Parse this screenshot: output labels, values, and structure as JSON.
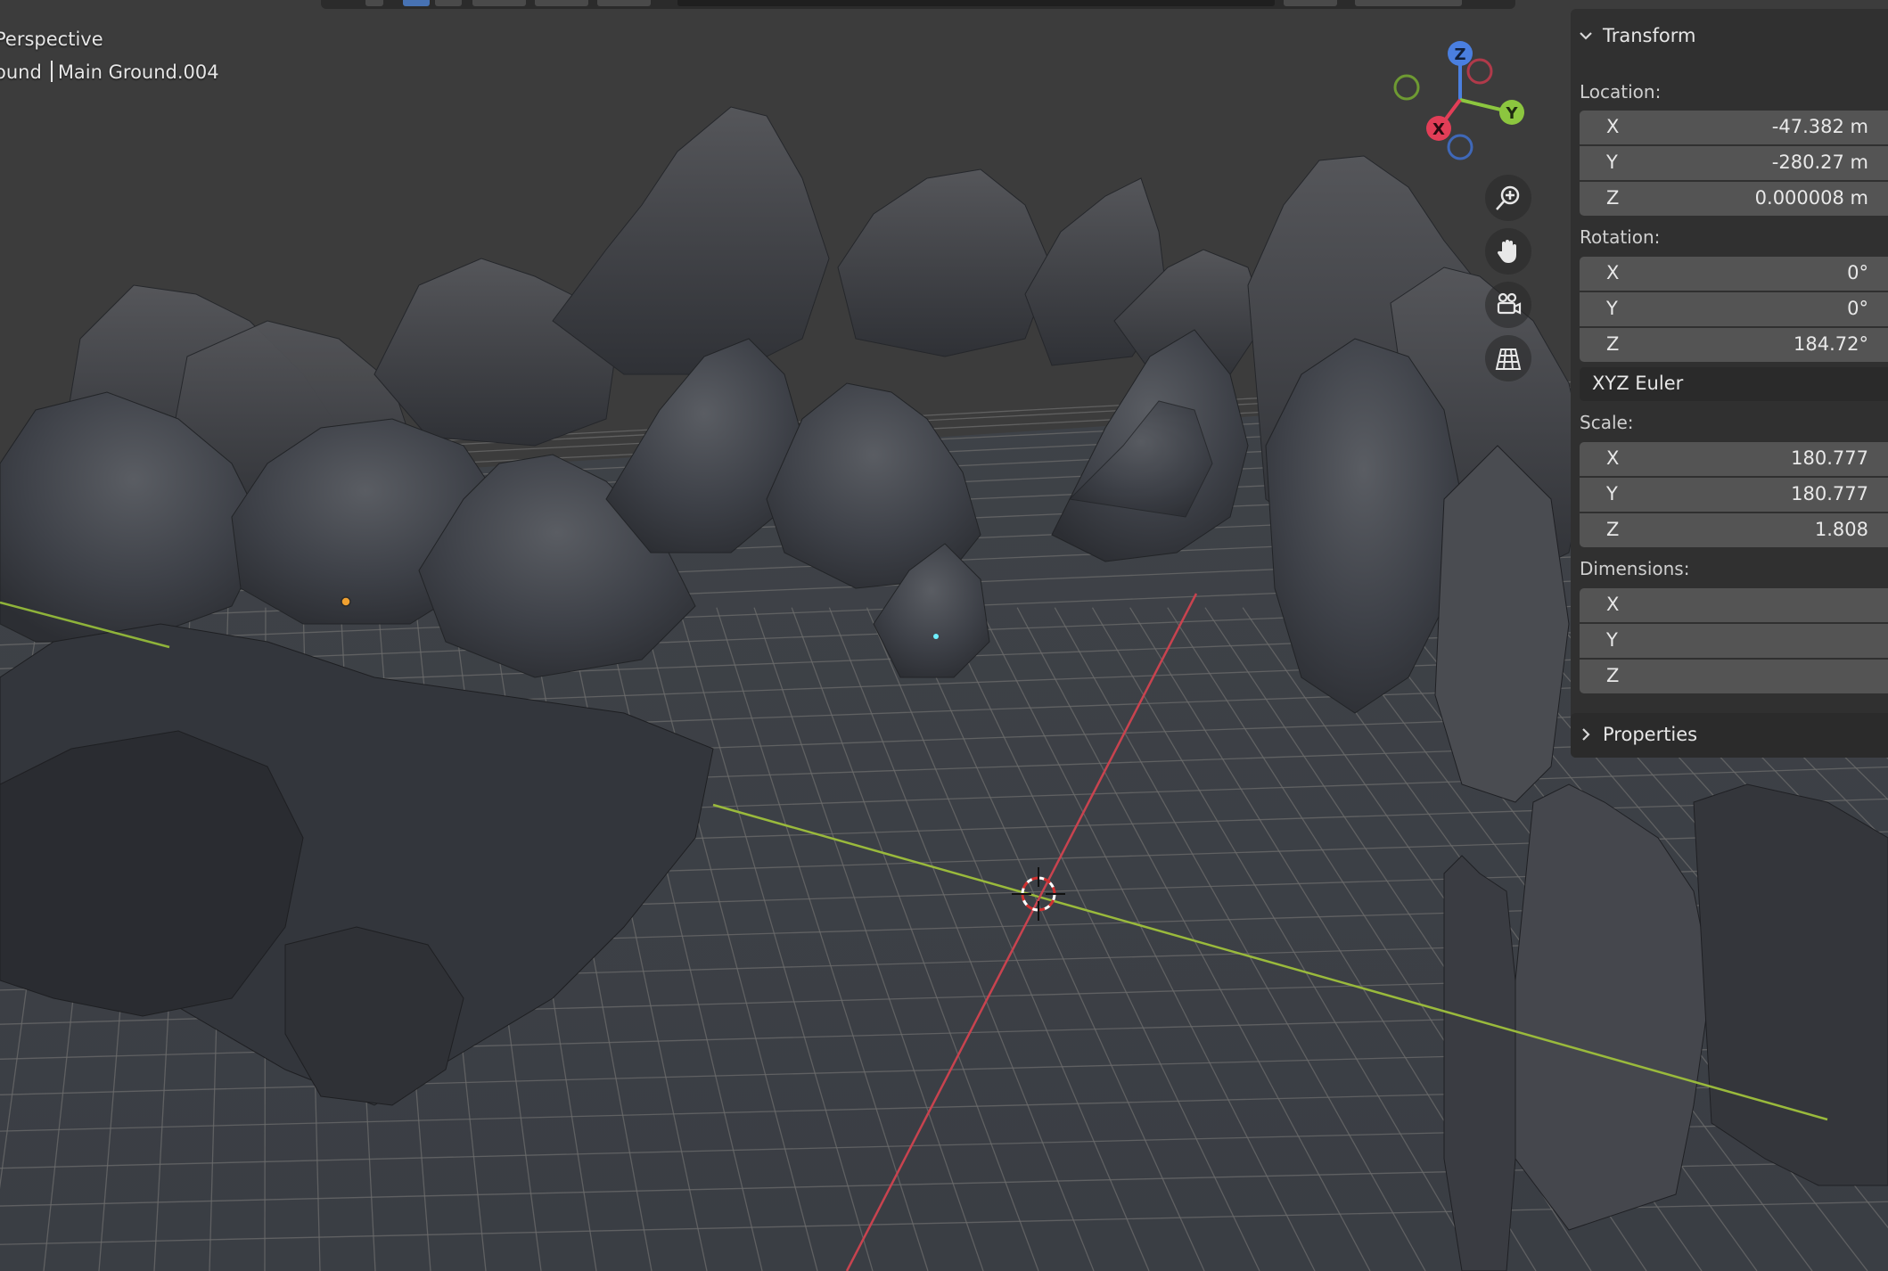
{
  "viewport": {
    "view_name": "Perspective",
    "object_collection": "ound",
    "object_name": "Main Ground.004"
  },
  "gizmo": {
    "axes": [
      "Z",
      "Y",
      "X"
    ],
    "colors": {
      "x": "#e23e57",
      "y": "#8cc63f",
      "z": "#4a7fe0"
    }
  },
  "nav_buttons": [
    {
      "name": "zoom-icon"
    },
    {
      "name": "hand-pan-icon"
    },
    {
      "name": "camera-icon"
    },
    {
      "name": "grid-ortho-icon"
    }
  ],
  "npanel": {
    "transform_header": "Transform",
    "location_label": "Location:",
    "location": [
      {
        "axis": "X",
        "value": "-47.382 m"
      },
      {
        "axis": "Y",
        "value": "-280.27 m"
      },
      {
        "axis": "Z",
        "value": "0.000008 m"
      }
    ],
    "rotation_label": "Rotation:",
    "rotation": [
      {
        "axis": "X",
        "value": "0°"
      },
      {
        "axis": "Y",
        "value": "0°"
      },
      {
        "axis": "Z",
        "value": "184.72°"
      }
    ],
    "rotation_mode": "XYZ Euler",
    "scale_label": "Scale:",
    "scale": [
      {
        "axis": "X",
        "value": "180.777"
      },
      {
        "axis": "Y",
        "value": "180.777"
      },
      {
        "axis": "Z",
        "value": "1.808"
      }
    ],
    "dimensions_label": "Dimensions:",
    "dimensions": [
      {
        "axis": "X",
        "value": ""
      },
      {
        "axis": "Y",
        "value": ""
      },
      {
        "axis": "Z",
        "value": ""
      }
    ],
    "properties_header": "Properties"
  }
}
